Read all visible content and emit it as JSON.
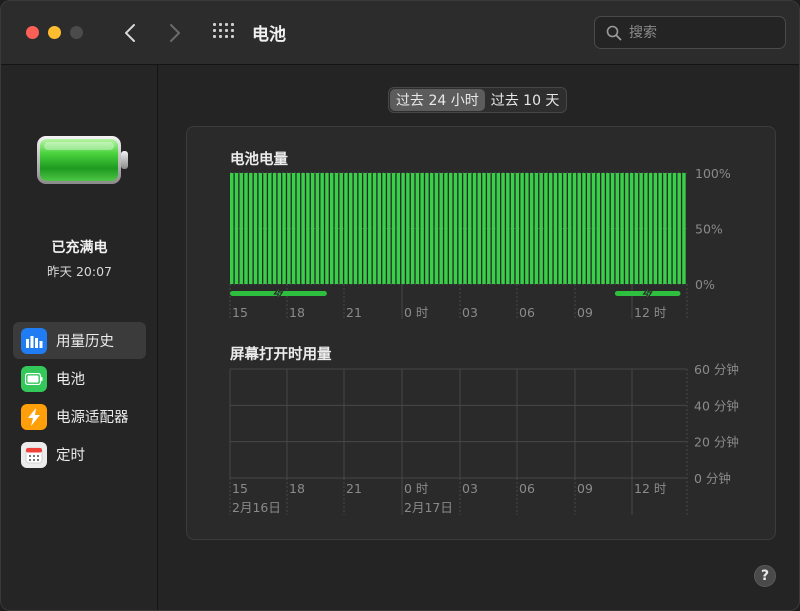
{
  "window": {
    "title": "电池"
  },
  "search": {
    "placeholder": "搜索"
  },
  "sidebar": {
    "status": "已充满电",
    "status_time": "昨天 20:07",
    "items": [
      {
        "label": "用量历史",
        "icon": "usage-history-icon",
        "color": "#1f7cf2",
        "selected": true
      },
      {
        "label": "电池",
        "icon": "battery-icon",
        "color": "#34c759",
        "selected": false
      },
      {
        "label": "电源适配器",
        "icon": "power-adapter-icon",
        "color": "#ff9f0a",
        "selected": false
      },
      {
        "label": "定时",
        "icon": "schedule-icon",
        "color": "#ececec",
        "selected": false
      }
    ]
  },
  "range_tabs": [
    {
      "label": "过去 24 小时",
      "active": true
    },
    {
      "label": "过去 10 天",
      "active": false
    }
  ],
  "help": {
    "label": "?"
  },
  "colors": {
    "battery_green": "#38d048",
    "charging_green": "#2fbf3f",
    "panel_bg": "#2a2a2a"
  },
  "chart_data": [
    {
      "type": "bar",
      "title": "电池电量",
      "x_ticks": [
        "15",
        "18",
        "21",
        "0 时",
        "03",
        "06",
        "09",
        "12 时"
      ],
      "y_ticks": [
        "100%",
        "50%",
        "0%"
      ],
      "ylim": [
        0,
        100
      ],
      "bar_count": 96,
      "values_note_level": 100,
      "charging_periods": [
        {
          "from_tick": 0,
          "to_tick": 1.7
        },
        {
          "from_tick": 6.7,
          "to_tick": 7.85
        }
      ]
    },
    {
      "type": "bar",
      "title": "屏幕打开时用量",
      "x_ticks": [
        "15",
        "18",
        "21",
        "0 时",
        "03",
        "06",
        "09",
        "12 时"
      ],
      "date_labels": [
        {
          "label": "2月16日",
          "at_tick": 0
        },
        {
          "label": "2月17日",
          "at_tick": 3
        }
      ],
      "y_ticks": [
        "60 分钟",
        "40 分钟",
        "20 分钟",
        "0 分钟"
      ],
      "ylim": [
        0,
        60
      ],
      "values": []
    }
  ]
}
